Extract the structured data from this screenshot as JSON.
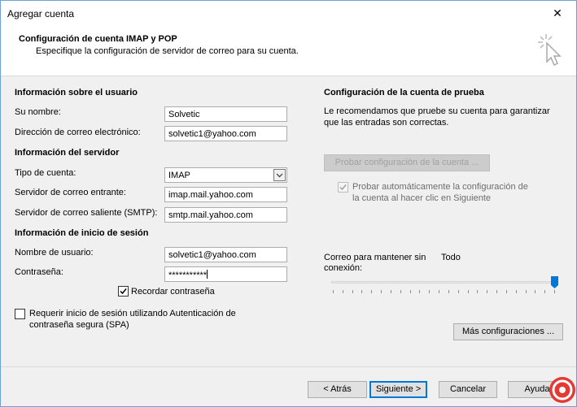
{
  "window": {
    "title": "Agregar cuenta",
    "close_glyph": "✕"
  },
  "header": {
    "title": "Configuración de cuenta IMAP y POP",
    "subtitle": "Especifique la configuración de servidor de correo para su cuenta.",
    "icon": "cursor-click-icon"
  },
  "user_info": {
    "heading": "Información sobre el usuario",
    "name_label": "Su nombre:",
    "name_value": "Solvetic",
    "email_label": "Dirección de correo electrónico:",
    "email_value": "solvetic1@yahoo.com"
  },
  "server_info": {
    "heading": "Información del servidor",
    "account_type_label": "Tipo de cuenta:",
    "account_type_value": "IMAP",
    "incoming_label": "Servidor de correo entrante:",
    "incoming_value": "imap.mail.yahoo.com",
    "outgoing_label": "Servidor de correo saliente (SMTP):",
    "outgoing_value": "smtp.mail.yahoo.com"
  },
  "login_info": {
    "heading": "Información de inicio de sesión",
    "username_label": "Nombre de usuario:",
    "username_value": "solvetic1@yahoo.com",
    "password_label": "Contraseña:",
    "password_value": "***********",
    "remember_label": "Recordar contraseña",
    "remember_checked": true,
    "spa_label_line1": "Requerir inicio de sesión utilizando Autenticación de",
    "spa_label_line2": "contraseña segura (SPA)",
    "spa_checked": false
  },
  "test_settings": {
    "heading": "Configuración de la cuenta de prueba",
    "description_line1": "Le recomendamos que pruebe su cuenta para garantizar",
    "description_line2": "que las entradas son correctas.",
    "test_button": "Probar configuración de la cuenta ...",
    "auto_test_line1": "Probar automáticamente la configuración de",
    "auto_test_line2": "la cuenta al hacer clic en Siguiente",
    "auto_test_checked": true
  },
  "offline": {
    "label_line1": "Correo para mantener sin",
    "label_line2": "conexión:",
    "value": "Todo",
    "slider_position": 1.0
  },
  "more_settings_button": "Más configuraciones ...",
  "footer": {
    "back": "< Atrás",
    "next": "Siguiente >",
    "cancel": "Cancelar",
    "help": "Ayuda"
  },
  "colors": {
    "accent": "#0078d7",
    "dialog_bg": "#f0f0f0",
    "watermark": "#e53935"
  }
}
